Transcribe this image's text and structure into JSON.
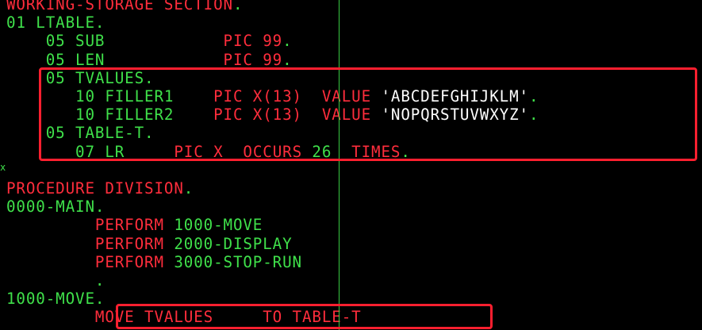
{
  "colors": {
    "background": "#000000",
    "green": "#3fe04a",
    "red": "#ff2d3c",
    "white": "#ffffff",
    "highlight": "#ff1f2f"
  },
  "editor": {
    "left_marker": "x",
    "lines": [
      {
        "segments": [
          {
            "t": "WORKING-STORAGE SECTION",
            "c": "r"
          },
          {
            "t": ".",
            "c": "g"
          }
        ]
      },
      {
        "segments": [
          {
            "t": "01 LTABLE.",
            "c": "g"
          }
        ]
      },
      {
        "segments": [
          {
            "t": "    05 SUB",
            "c": "g"
          },
          {
            "t": "            ",
            "c": "g"
          },
          {
            "t": "PIC 99",
            "c": "r"
          },
          {
            "t": ".",
            "c": "g"
          }
        ]
      },
      {
        "segments": [
          {
            "t": "    05 LEN",
            "c": "g"
          },
          {
            "t": "            ",
            "c": "g"
          },
          {
            "t": "PIC 99",
            "c": "r"
          },
          {
            "t": ".",
            "c": "g"
          }
        ]
      },
      {
        "segments": [
          {
            "t": "    05 TVALUES.",
            "c": "g"
          }
        ]
      },
      {
        "segments": [
          {
            "t": "       10 FILLER1",
            "c": "g"
          },
          {
            "t": "    ",
            "c": "g"
          },
          {
            "t": "PIC X(13)",
            "c": "r"
          },
          {
            "t": "  ",
            "c": "g"
          },
          {
            "t": "VALUE",
            "c": "r"
          },
          {
            "t": " ",
            "c": "g"
          },
          {
            "t": "'ABCDEFGHIJKLM'",
            "c": "w"
          },
          {
            "t": ".",
            "c": "g"
          }
        ]
      },
      {
        "segments": [
          {
            "t": "       10 FILLER2",
            "c": "g"
          },
          {
            "t": "    ",
            "c": "g"
          },
          {
            "t": "PIC X(13)",
            "c": "r"
          },
          {
            "t": "  ",
            "c": "g"
          },
          {
            "t": "VALUE",
            "c": "r"
          },
          {
            "t": " ",
            "c": "g"
          },
          {
            "t": "'NOPQRSTUVWXYZ'",
            "c": "w"
          },
          {
            "t": ".",
            "c": "g"
          }
        ]
      },
      {
        "segments": [
          {
            "t": "    05 TABLE-T.",
            "c": "g"
          }
        ]
      },
      {
        "segments": [
          {
            "t": "       07 LR",
            "c": "g"
          },
          {
            "t": "     ",
            "c": "g"
          },
          {
            "t": "PIC X",
            "c": "r"
          },
          {
            "t": "  ",
            "c": "g"
          },
          {
            "t": "OCCURS",
            "c": "r"
          },
          {
            "t": " 26  ",
            "c": "g"
          },
          {
            "t": "TIMES",
            "c": "r"
          },
          {
            "t": ".",
            "c": "g"
          }
        ]
      },
      {
        "segments": [
          {
            "t": "",
            "c": "g"
          }
        ]
      },
      {
        "segments": [
          {
            "t": "PROCEDURE DIVISION",
            "c": "r"
          },
          {
            "t": ".",
            "c": "g"
          }
        ]
      },
      {
        "segments": [
          {
            "t": "0000-MAIN.",
            "c": "g"
          }
        ]
      },
      {
        "segments": [
          {
            "t": "         ",
            "c": "g"
          },
          {
            "t": "PERFORM",
            "c": "r"
          },
          {
            "t": " 1000-MOVE",
            "c": "g"
          }
        ]
      },
      {
        "segments": [
          {
            "t": "         ",
            "c": "g"
          },
          {
            "t": "PERFORM",
            "c": "r"
          },
          {
            "t": " 2000-DISPLAY",
            "c": "g"
          }
        ]
      },
      {
        "segments": [
          {
            "t": "         ",
            "c": "g"
          },
          {
            "t": "PERFORM",
            "c": "r"
          },
          {
            "t": " 3000-STOP-RUN",
            "c": "g"
          }
        ]
      },
      {
        "segments": [
          {
            "t": "         .",
            "c": "g"
          }
        ]
      },
      {
        "segments": [
          {
            "t": "1000-MOVE.",
            "c": "g"
          }
        ]
      },
      {
        "segments": [
          {
            "t": "         ",
            "c": "g"
          },
          {
            "t": "MOVE TVALUES",
            "c": "r"
          },
          {
            "t": "     ",
            "c": "g"
          },
          {
            "t": "TO TABLE-T",
            "c": "r"
          }
        ]
      }
    ]
  }
}
